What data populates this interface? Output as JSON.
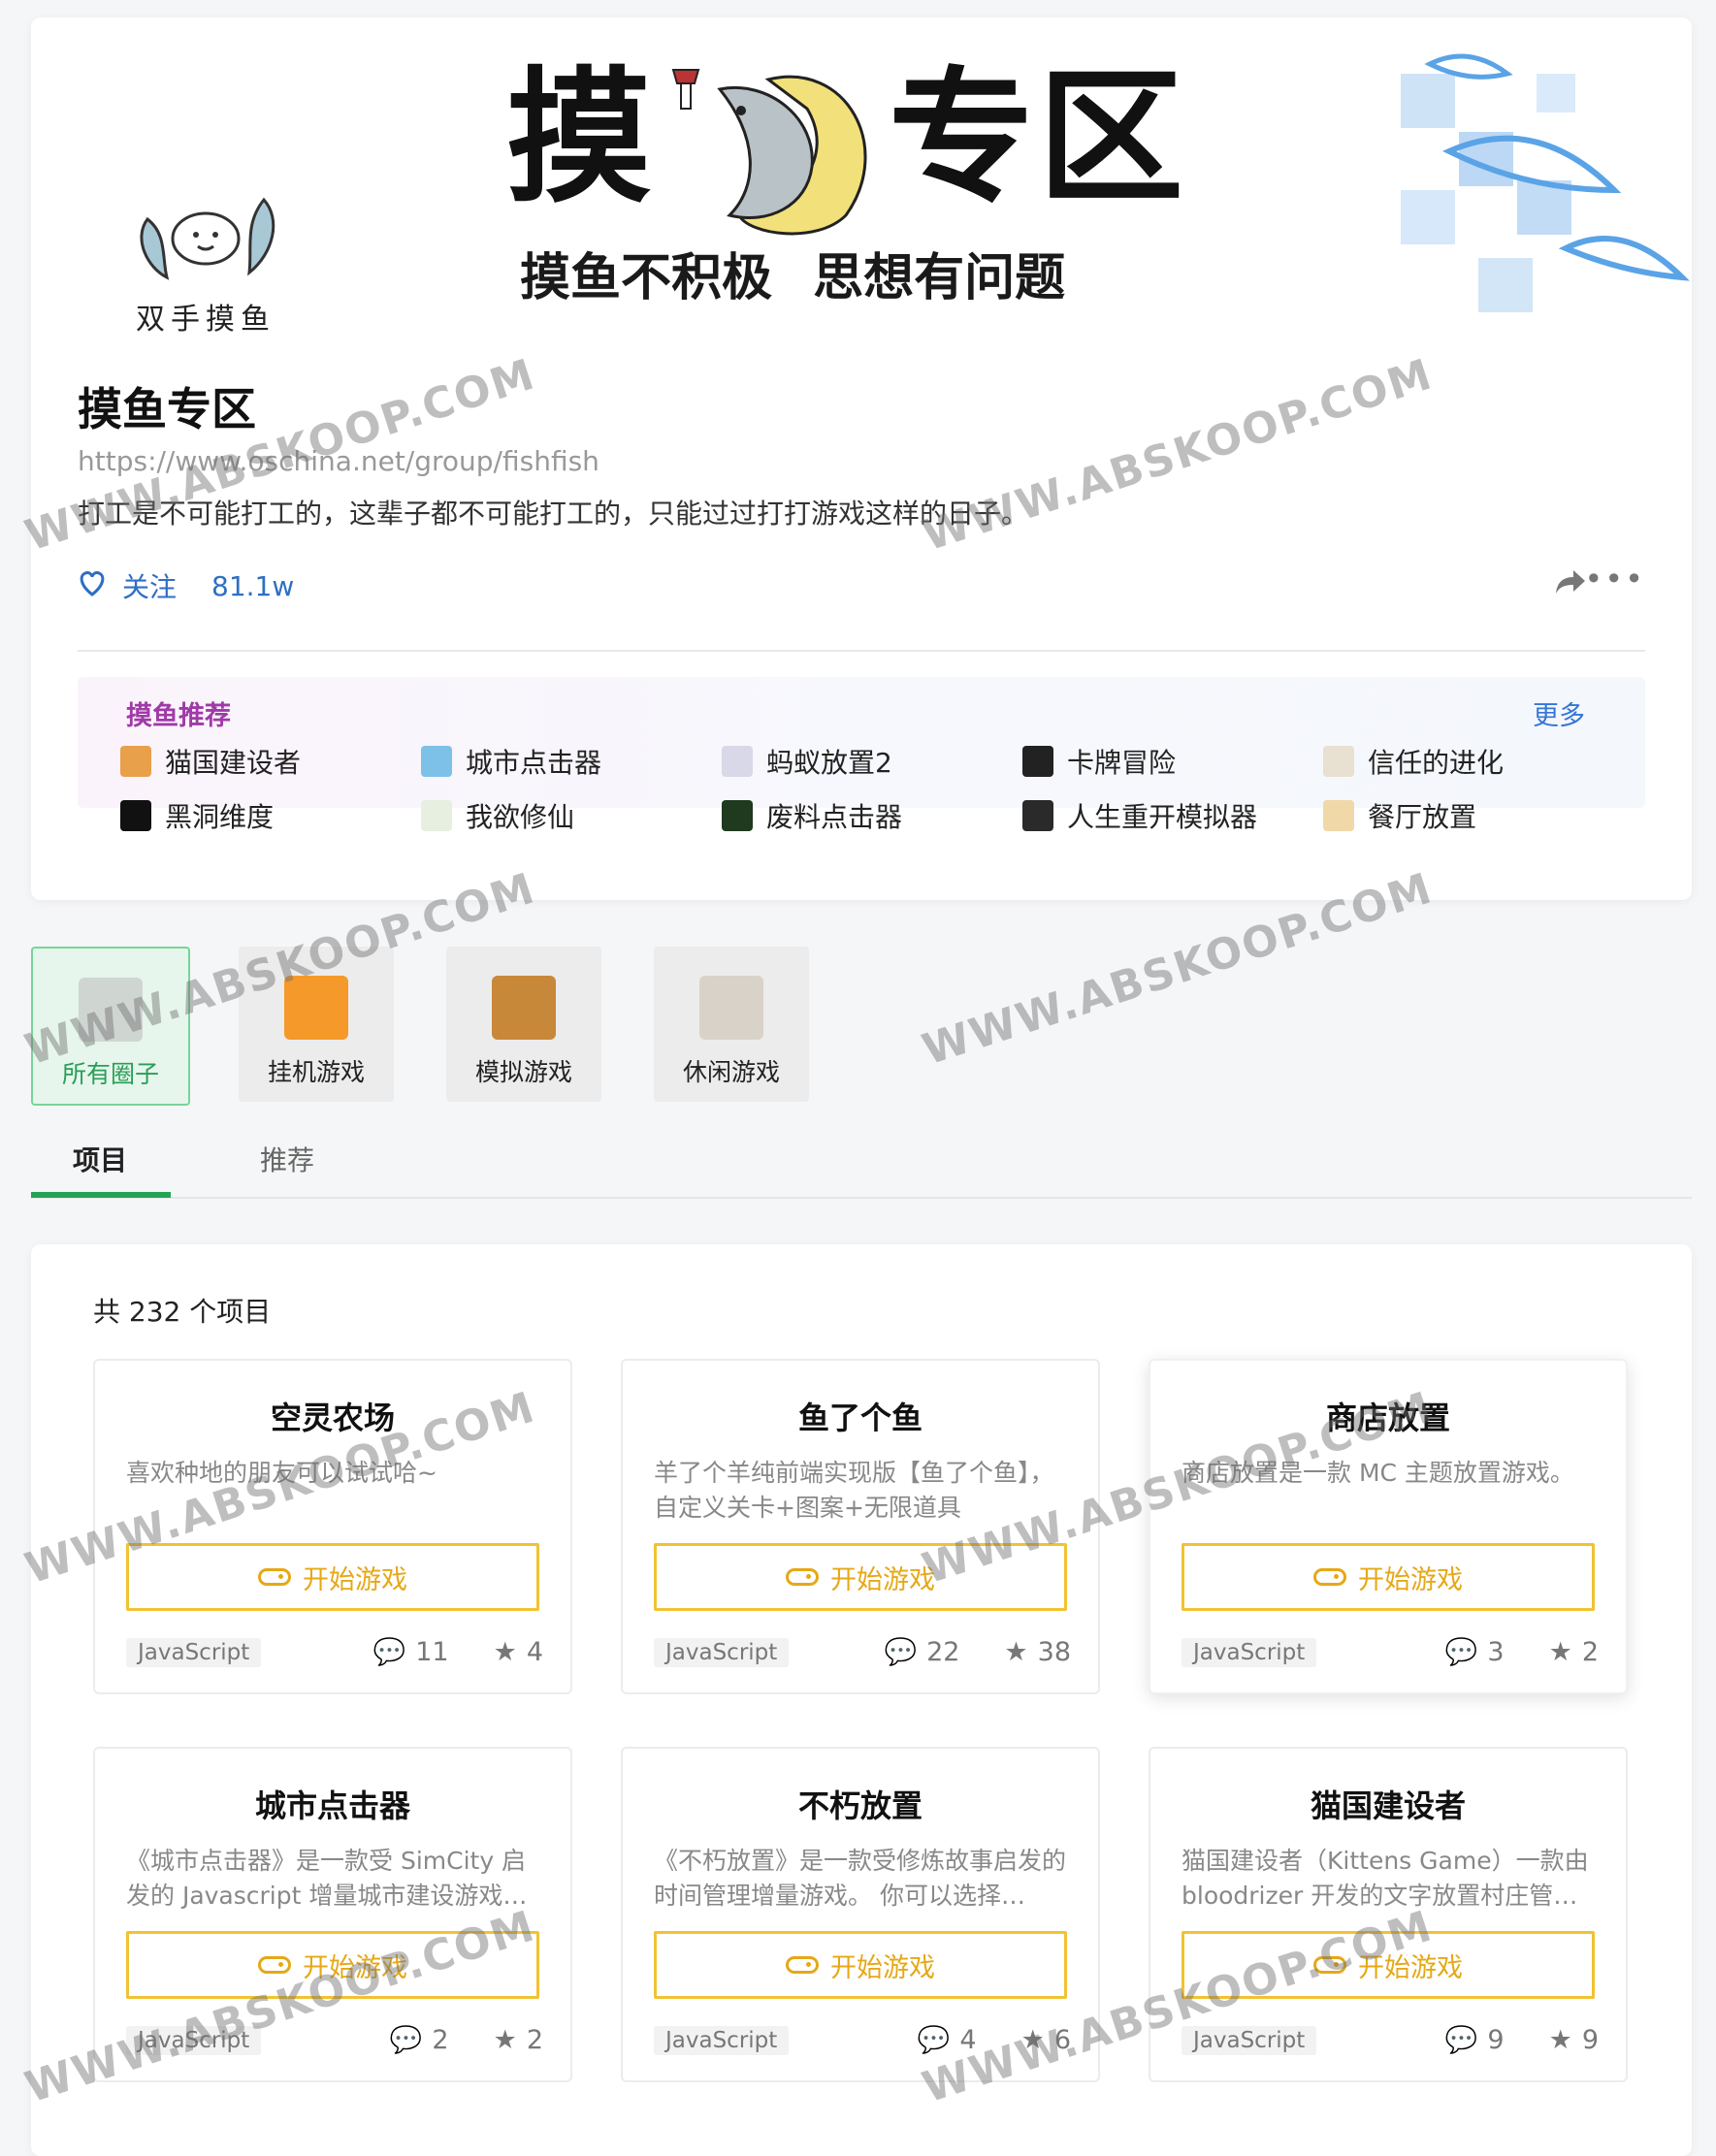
{
  "banner": {
    "title_left": "摸",
    "title_right": "专区",
    "subtitle": "摸鱼不积极 思想有问题",
    "logo_label": "双手摸鱼"
  },
  "group": {
    "name": "摸鱼专区",
    "url": "https://www.oschina.net/group/fishfish",
    "description": "打工是不可能打工的，这辈子都不可能打工的，只能过过打打游戏这样的日子。",
    "follow_label": "关注",
    "follower_count": "81.1w"
  },
  "recommend": {
    "title": "摸鱼推荐",
    "more_label": "更多",
    "items": [
      {
        "label": "猫国建设者",
        "color": "#e8a04a"
      },
      {
        "label": "城市点击器",
        "color": "#7ec1e8"
      },
      {
        "label": "蚂蚁放置2",
        "color": "#d8d8e8"
      },
      {
        "label": "卡牌冒险",
        "color": "#222222"
      },
      {
        "label": "信任的进化",
        "color": "#e8e0d0"
      },
      {
        "label": "黑洞维度",
        "color": "#111111"
      },
      {
        "label": "我欲修仙",
        "color": "#e6efe0"
      },
      {
        "label": "废料点击器",
        "color": "#1f3a1f"
      },
      {
        "label": "人生重开模拟器",
        "color": "#2a2a2a"
      },
      {
        "label": "餐厅放置",
        "color": "#f0d8a8"
      }
    ]
  },
  "categories": [
    {
      "label": "所有圈子",
      "icon": "circle-logo-icon",
      "color": "#cfd6d2"
    },
    {
      "label": "挂机游戏",
      "icon": "sun-glasses-icon",
      "color": "#f59a2a"
    },
    {
      "label": "模拟游戏",
      "icon": "dos-box-icon",
      "color": "#c8883a"
    },
    {
      "label": "休闲游戏",
      "icon": "cup-icon",
      "color": "#d9d2c8"
    }
  ],
  "tabs": {
    "projects": "项目",
    "recommend": "推荐"
  },
  "projects": {
    "count_text": "共 232 个项目",
    "play_label": "开始游戏",
    "items": [
      {
        "title": "空灵农场",
        "desc": "喜欢种地的朋友可以试试哈~",
        "lang": "JavaScript",
        "comments": "11",
        "stars": "4"
      },
      {
        "title": "鱼了个鱼",
        "desc": "羊了个羊纯前端实现版【鱼了个鱼】，自定义关卡+图案+无限道具",
        "lang": "JavaScript",
        "comments": "22",
        "stars": "38"
      },
      {
        "title": "商店放置",
        "desc": "商店放置是一款 MC 主题放置游戏。",
        "lang": "JavaScript",
        "comments": "3",
        "stars": "2"
      },
      {
        "title": "城市点击器",
        "desc": "《城市点击器》是一款受 SimCity 启发的 Javascript 增量城市建设游戏…",
        "lang": "JavaScript",
        "comments": "2",
        "stars": "2"
      },
      {
        "title": "不朽放置",
        "desc": "《不朽放置》是一款受修炼故事启发的时间管理增量游戏。 你可以选择…",
        "lang": "JavaScript",
        "comments": "4",
        "stars": "6"
      },
      {
        "title": "猫国建设者",
        "desc": "猫国建设者（Kittens Game）一款由 bloodrizer 开发的文字放置村庄管…",
        "lang": "JavaScript",
        "comments": "9",
        "stars": "9"
      }
    ]
  },
  "watermark": "WWW.ABSKOOP.COM"
}
